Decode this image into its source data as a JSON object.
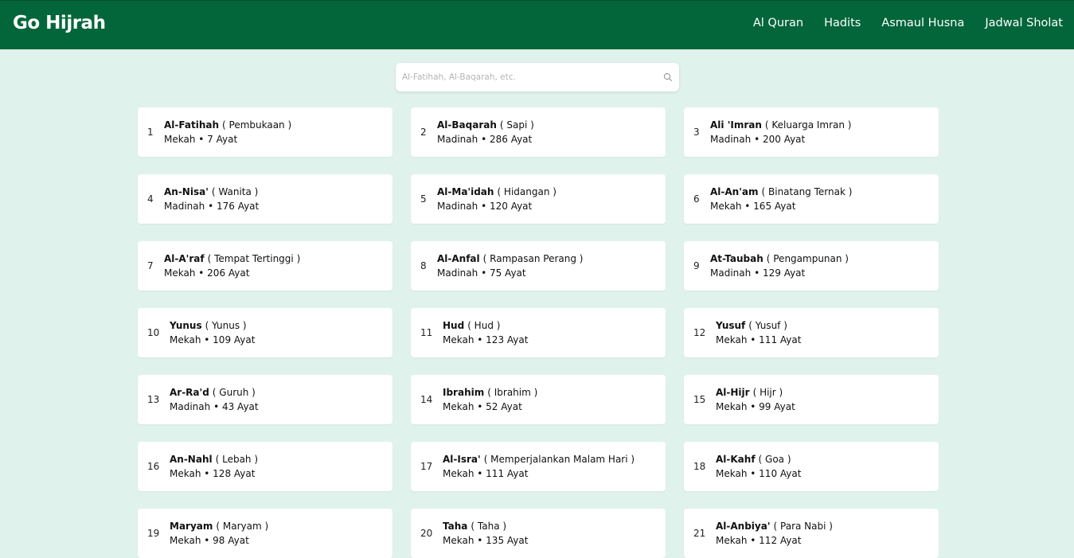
{
  "app": {
    "brand": "Go Hijrah"
  },
  "nav": {
    "items": [
      {
        "label": "Al Quran"
      },
      {
        "label": "Hadits"
      },
      {
        "label": "Asmaul Husna"
      },
      {
        "label": "Jadwal Sholat"
      }
    ]
  },
  "search": {
    "placeholder": "Al-Fatihah, Al-Baqarah, etc.",
    "value": ""
  },
  "surahs": [
    {
      "number": "1",
      "name": "Al-Fatihah",
      "meaning": "( Pembukaan )",
      "place": "Mekah",
      "ayat": "7 Ayat"
    },
    {
      "number": "2",
      "name": "Al-Baqarah",
      "meaning": "( Sapi )",
      "place": "Madinah",
      "ayat": "286 Ayat"
    },
    {
      "number": "3",
      "name": "Ali 'Imran",
      "meaning": "( Keluarga Imran )",
      "place": "Madinah",
      "ayat": "200 Ayat"
    },
    {
      "number": "4",
      "name": "An-Nisa'",
      "meaning": "( Wanita )",
      "place": "Madinah",
      "ayat": "176 Ayat"
    },
    {
      "number": "5",
      "name": "Al-Ma'idah",
      "meaning": "( Hidangan )",
      "place": "Madinah",
      "ayat": "120 Ayat"
    },
    {
      "number": "6",
      "name": "Al-An'am",
      "meaning": "( Binatang Ternak )",
      "place": "Mekah",
      "ayat": "165 Ayat"
    },
    {
      "number": "7",
      "name": "Al-A'raf",
      "meaning": "( Tempat Tertinggi )",
      "place": "Mekah",
      "ayat": "206 Ayat"
    },
    {
      "number": "8",
      "name": "Al-Anfal",
      "meaning": "( Rampasan Perang )",
      "place": "Madinah",
      "ayat": "75 Ayat"
    },
    {
      "number": "9",
      "name": "At-Taubah",
      "meaning": "( Pengampunan )",
      "place": "Madinah",
      "ayat": "129 Ayat"
    },
    {
      "number": "10",
      "name": "Yunus",
      "meaning": "( Yunus )",
      "place": "Mekah",
      "ayat": "109 Ayat"
    },
    {
      "number": "11",
      "name": "Hud",
      "meaning": "( Hud )",
      "place": "Mekah",
      "ayat": "123 Ayat"
    },
    {
      "number": "12",
      "name": "Yusuf",
      "meaning": "( Yusuf )",
      "place": "Mekah",
      "ayat": "111 Ayat"
    },
    {
      "number": "13",
      "name": "Ar-Ra'd",
      "meaning": "( Guruh )",
      "place": "Madinah",
      "ayat": "43 Ayat"
    },
    {
      "number": "14",
      "name": "Ibrahim",
      "meaning": "( Ibrahim )",
      "place": "Mekah",
      "ayat": "52 Ayat"
    },
    {
      "number": "15",
      "name": "Al-Hijr",
      "meaning": "( Hijr )",
      "place": "Mekah",
      "ayat": "99 Ayat"
    },
    {
      "number": "16",
      "name": "An-Nahl",
      "meaning": "( Lebah )",
      "place": "Mekah",
      "ayat": "128 Ayat"
    },
    {
      "number": "17",
      "name": "Al-Isra'",
      "meaning": "( Memperjalankan Malam Hari )",
      "place": "Mekah",
      "ayat": "111 Ayat"
    },
    {
      "number": "18",
      "name": "Al-Kahf",
      "meaning": "( Goa )",
      "place": "Mekah",
      "ayat": "110 Ayat"
    },
    {
      "number": "19",
      "name": "Maryam",
      "meaning": "( Maryam )",
      "place": "Mekah",
      "ayat": "98 Ayat"
    },
    {
      "number": "20",
      "name": "Taha",
      "meaning": "( Taha )",
      "place": "Mekah",
      "ayat": "135 Ayat"
    },
    {
      "number": "21",
      "name": "Al-Anbiya'",
      "meaning": "( Para Nabi )",
      "place": "Mekah",
      "ayat": "112 Ayat"
    }
  ],
  "separator": "•",
  "colors": {
    "header": "#03663a",
    "background": "#e0f2ec",
    "card": "#ffffff"
  }
}
